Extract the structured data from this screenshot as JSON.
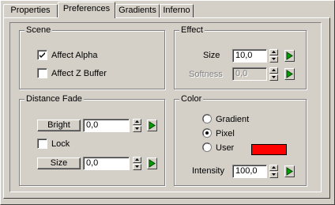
{
  "tabs": [
    {
      "label": "Properties",
      "active": false
    },
    {
      "label": "Preferences",
      "active": true
    },
    {
      "label": "Gradients",
      "active": false
    },
    {
      "label": "Inferno",
      "active": false
    }
  ],
  "scene": {
    "title": "Scene",
    "affect_alpha": {
      "label": "Affect Alpha",
      "checked": true
    },
    "affect_z_buffer": {
      "label": "Affect Z Buffer",
      "checked": false
    }
  },
  "effect": {
    "title": "Effect",
    "size": {
      "label": "Size",
      "value": "10,0"
    },
    "softness": {
      "label": "Softness",
      "value": "0,0",
      "disabled": true
    }
  },
  "distance_fade": {
    "title": "Distance Fade",
    "bright": {
      "button_label": "Bright",
      "value": "0,0"
    },
    "lock": {
      "label": "Lock",
      "checked": false
    },
    "size": {
      "button_label": "Size",
      "value": "0,0"
    }
  },
  "color": {
    "title": "Color",
    "options": [
      {
        "label": "Gradient",
        "selected": false
      },
      {
        "label": "Pixel",
        "selected": true
      },
      {
        "label": "User",
        "selected": false
      }
    ],
    "user_color": "#ff0000",
    "intensity": {
      "label": "Intensity",
      "value": "100,0"
    }
  },
  "colors": {
    "face": "#d4d0c8",
    "go_arrow": "#00a000"
  }
}
